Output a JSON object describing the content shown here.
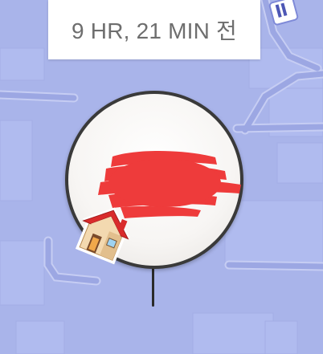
{
  "time_label": "9 HR, 21 MIN 전",
  "icons": {
    "home": "house-emoji",
    "map_label": "road-sign-fragment"
  },
  "colors": {
    "map_bg": "#a9b4ea",
    "road": "#9aa6e2",
    "road_outline": "#c3caf2",
    "card_bg": "#ffffff",
    "card_text": "#6e6e6e",
    "redaction": "#ee3b3b",
    "roof": "#d92b2b"
  }
}
